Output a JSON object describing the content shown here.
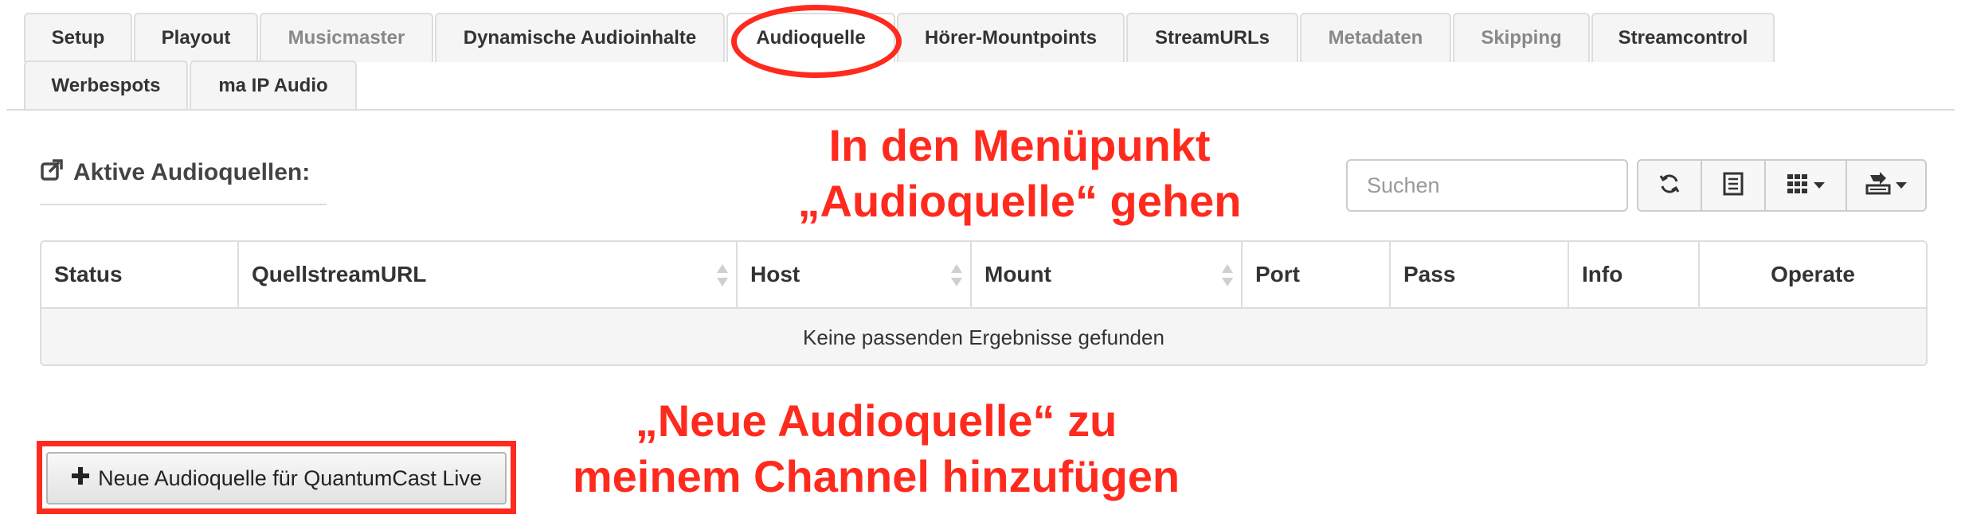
{
  "tabs": [
    {
      "label": "Setup",
      "state": "normal"
    },
    {
      "label": "Playout",
      "state": "normal"
    },
    {
      "label": "Musicmaster",
      "state": "muted"
    },
    {
      "label": "Dynamische Audioinhalte",
      "state": "normal"
    },
    {
      "label": "Audioquelle",
      "state": "active"
    },
    {
      "label": "Hörer-Mountpoints",
      "state": "normal"
    },
    {
      "label": "StreamURLs",
      "state": "normal"
    },
    {
      "label": "Metadaten",
      "state": "muted"
    },
    {
      "label": "Skipping",
      "state": "muted"
    },
    {
      "label": "Streamcontrol",
      "state": "normal"
    },
    {
      "label": "Werbespots",
      "state": "normal"
    },
    {
      "label": "ma IP Audio",
      "state": "normal"
    }
  ],
  "section": {
    "title": "Aktive Audioquellen:"
  },
  "toolbar": {
    "search_placeholder": "Suchen",
    "buttons": [
      "refresh-icon",
      "toggle-view-icon",
      "columns-icon",
      "export-icon"
    ]
  },
  "table": {
    "columns": [
      "Status",
      "QuellstreamURL",
      "Host",
      "Mount",
      "Port",
      "Pass",
      "Info",
      "Operate"
    ],
    "empty_text": "Keine passenden Ergebnisse gefunden"
  },
  "add_button": {
    "label": "Neue Audioquelle für QuantumCast Live"
  },
  "annotations": {
    "menu_hint_line1": "In den Menüpunkt",
    "menu_hint_line2": "„Audioquelle“ gehen",
    "add_hint_line1": "„Neue Audioquelle“ zu",
    "add_hint_line2": "meinem Channel hinzufügen",
    "color": "#ff2a1e"
  }
}
